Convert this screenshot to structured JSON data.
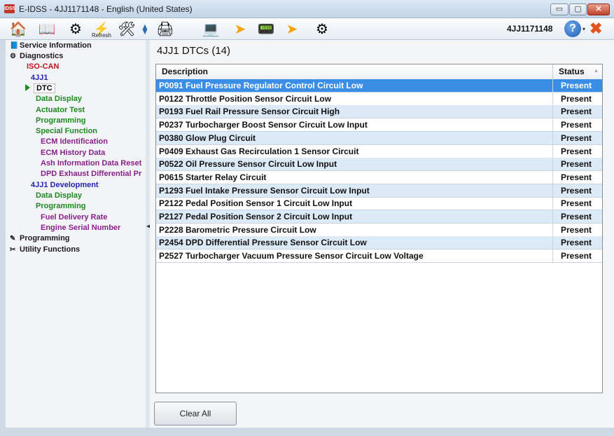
{
  "window": {
    "app_icon": "IDSS",
    "title": "E-IDSS - 4JJ1171148 - English (United States)",
    "minimize": "▭",
    "maximize": "▢",
    "close": "✕"
  },
  "toolbar": {
    "icons": [
      "home-icon",
      "book-icon",
      "engine-icon",
      "refresh-icon",
      "tools-icon",
      "pin-icon",
      "printer-icon",
      "laptop-icon",
      "arrow-icon",
      "device-icon",
      "arrow-icon",
      "engine-icon"
    ],
    "refresh_label": "Refresh",
    "vin": "4JJ1171148",
    "help_icon": "?",
    "help_dropdown": "▾",
    "exit_icon": "✖"
  },
  "tree": {
    "service_information": "Service Information",
    "diagnostics": "Diagnostics",
    "iso_can": "ISO-CAN",
    "engine_4jj1": "4JJ1",
    "dtc": "DTC",
    "data_display": "Data Display",
    "actuator_test": "Actuator Test",
    "programming": "Programming",
    "special_function": "Special Function",
    "ecm_identification": "ECM Identification",
    "ecm_history_data": "ECM History Data",
    "ash_information_data_reset": "Ash Information Data Reset",
    "dpd_exhaust_differential": "DPD Exhaust Differential Pr",
    "dev_4jj1": "4JJ1 Development",
    "dev_data_display": "Data Display",
    "dev_programming": "Programming",
    "fuel_delivery_rate": "Fuel Delivery Rate",
    "engine_serial_number": "Engine Serial Number",
    "programming_root": "Programming",
    "utility_functions": "Utility Functions"
  },
  "main": {
    "title": "4JJ1 DTCs  (14)",
    "columns": {
      "description": "Description",
      "status": "Status"
    },
    "rows": [
      {
        "description": "P0091 Fuel Pressure Regulator Control Circuit Low",
        "status": "Present"
      },
      {
        "description": "P0122 Throttle Position Sensor Circuit Low",
        "status": "Present"
      },
      {
        "description": "P0193 Fuel Rail Pressure Sensor Circuit High",
        "status": "Present"
      },
      {
        "description": "P0237 Turbocharger Boost Sensor Circuit Low Input",
        "status": "Present"
      },
      {
        "description": "P0380 Glow Plug Circuit",
        "status": "Present"
      },
      {
        "description": "P0409 Exhaust Gas Recirculation 1 Sensor Circuit",
        "status": "Present"
      },
      {
        "description": "P0522 Oil Pressure Sensor Circuit Low Input",
        "status": "Present"
      },
      {
        "description": "P0615 Starter Relay Circuit",
        "status": "Present"
      },
      {
        "description": "P1293 Fuel Intake Pressure Sensor Circuit Low Input",
        "status": "Present"
      },
      {
        "description": "P2122 Pedal Position Sensor 1 Circuit Low Input",
        "status": "Present"
      },
      {
        "description": "P2127 Pedal Position Sensor 2 Circuit Low Input",
        "status": "Present"
      },
      {
        "description": "P2228 Barometric Pressure Circuit Low",
        "status": "Present"
      },
      {
        "description": "P2454 DPD Differential Pressure Sensor Circuit Low",
        "status": "Present"
      },
      {
        "description": "P2527 Turbocharger Vacuum Pressure Sensor Circuit Low Voltage",
        "status": "Present"
      }
    ],
    "clear_all": "Clear All"
  },
  "colors": {
    "selected_row": "#3a8ee6",
    "alt_row": "#dce9f7",
    "tree_red": "#c0141e",
    "tree_blue": "#2222b8",
    "tree_green": "#1e8a1e",
    "tree_purple": "#8a1f8a"
  }
}
